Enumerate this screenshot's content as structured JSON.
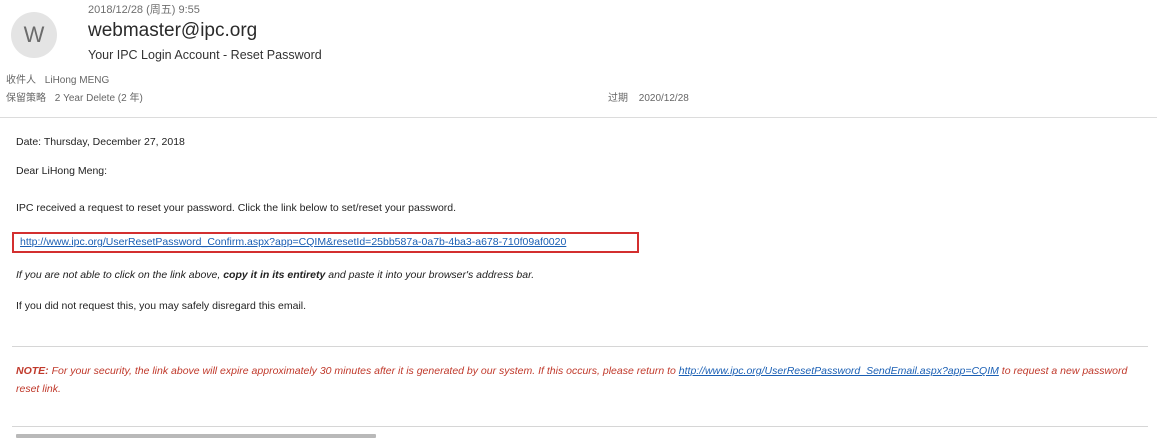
{
  "header": {
    "avatar_letter": "W",
    "sent_time": "2018/12/28 (周五) 9:55",
    "sender": "webmaster@ipc.org",
    "subject": "Your IPC Login Account - Reset Password",
    "to_label": "收件人",
    "to_value": "LiHong MENG",
    "policy_label": "保留策略",
    "policy_value": "2 Year Delete (2 年)",
    "expiry_label": "过期",
    "expiry_value": "2020/12/28"
  },
  "body": {
    "date_line": "Date: Thursday, December 27, 2018",
    "greeting": "Dear LiHong Meng:",
    "request_line": "IPC received a request to reset your password. Click the link below to set/reset your password.",
    "reset_link": "http://www.ipc.org/UserResetPassword_Confirm.aspx?app=CQIM&resetId=25bb587a-0a7b-4ba3-a678-710f09af0020",
    "copy_line_part1": "If you are not able to click on the link above, ",
    "copy_line_bold": "copy it in its entirety",
    "copy_line_part2": " and paste it into your browser's address bar.",
    "disregard_line": "If you did not request this, you may safely disregard this email.",
    "note_label": "NOTE:",
    "note_text": " For your security, the link above will expire approximately 30 minutes after it is generated by our system. If this occurs, please return to ",
    "note_link": "http://www.ipc.org/UserResetPassword_SendEmail.aspx?app=CQIM",
    "note_text_end": " to request a new password reset link."
  },
  "colors": {
    "link": "#1a5fb4",
    "note": "#c0392b",
    "highlight_box": "#d32f2f"
  }
}
